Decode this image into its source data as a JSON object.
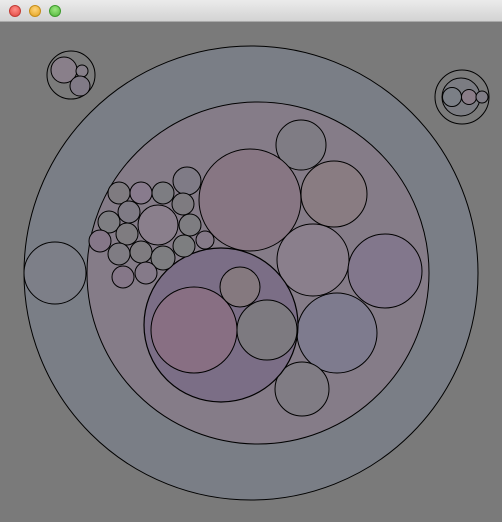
{
  "window": {
    "buttons": {
      "close": "close",
      "minimize": "minimize",
      "zoom": "zoom"
    }
  },
  "colors": {
    "background": "#7a7a7a",
    "outer_ring": "#7a7e86",
    "middle_ring": "#857c88",
    "inner_cluster": "#7b6e86",
    "stroke": "#000000"
  }
}
